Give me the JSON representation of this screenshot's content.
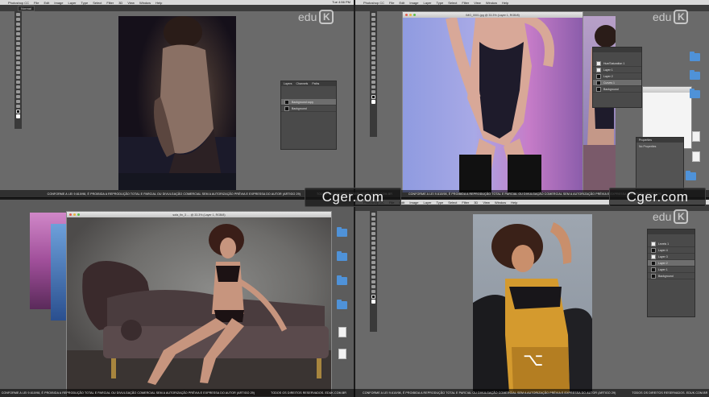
{
  "app": {
    "name": "Photoshop CC",
    "menus": [
      "File",
      "Edit",
      "Image",
      "Layer",
      "Type",
      "Select",
      "Filter",
      "3D",
      "View",
      "Window",
      "Help"
    ],
    "clock": "Tue 4:56 PM"
  },
  "options_bar": {
    "mode_label": "Normal"
  },
  "brand": {
    "edu_text": "edu",
    "edu_letter": "K",
    "cger_text": "Cger.com"
  },
  "watermark": {
    "notice": "CONFORME A LEI 9.610/98, É PROIBIDA A REPRODUÇÃO TOTAL E PARCIAL OU DIVULGAÇÃO COMERCIAL SEM A AUTORIZAÇÃO PRÉVIA E EXPRESSA DO AUTOR (ARTIGO 29)",
    "rights": "TODOS OS DIREITOS RESERVADOS. EDUK.COM.BR"
  },
  "quad1": {
    "layers_panel": {
      "tabs": [
        "Layers",
        "Channels",
        "Paths"
      ],
      "layers": [
        {
          "name": "Background copy"
        },
        {
          "name": "Background"
        }
      ]
    }
  },
  "quad2": {
    "doc_title": "IMG_0001.jpg @ 33.3% (Layer 1, RGB/8)",
    "layers_panel": {
      "layers": [
        {
          "name": "Hue/Saturation 1"
        },
        {
          "name": "Layer 1"
        },
        {
          "name": "Layer 2"
        },
        {
          "name": "Curves 1"
        },
        {
          "name": "Background"
        }
      ]
    },
    "properties_panel": {
      "title": "Properties",
      "body": "No Properties"
    }
  },
  "quad3": {
    "doc_title": "sofa_fin_3 … @ 33.3% (Layer 1, RGB/8)"
  },
  "quad4": {
    "layers_panel": {
      "layers": [
        {
          "name": "Levels 1"
        },
        {
          "name": "Layer 4"
        },
        {
          "name": "Layer 3"
        },
        {
          "name": "Layer 2"
        },
        {
          "name": "Layer 1"
        },
        {
          "name": "Background"
        }
      ]
    },
    "shortcut_glyph": "⌥"
  }
}
